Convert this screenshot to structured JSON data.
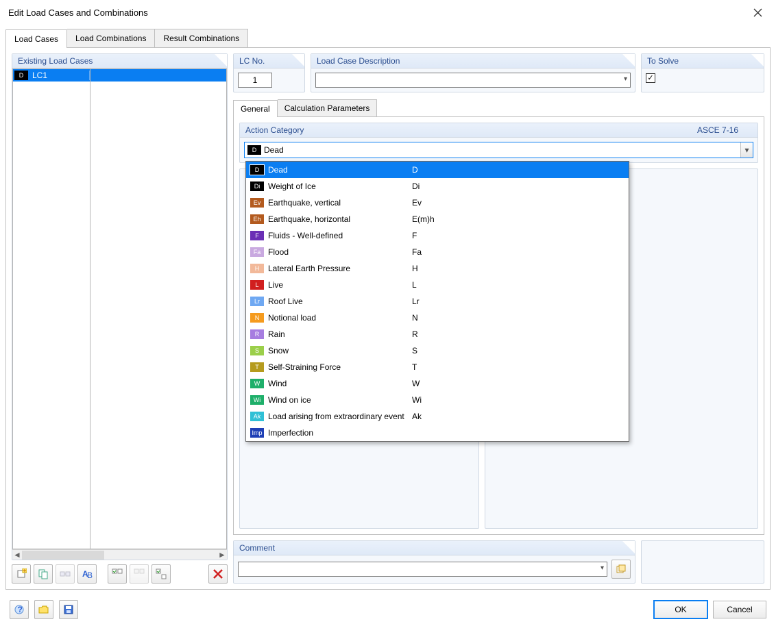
{
  "window": {
    "title": "Edit Load Cases and Combinations"
  },
  "main_tabs": {
    "load_cases": "Load Cases",
    "load_combinations": "Load Combinations",
    "result_combinations": "Result Combinations"
  },
  "left": {
    "existing_header": "Existing Load Cases",
    "rows": [
      {
        "tag": "D",
        "tag_bg": "#000000",
        "name": "LC1"
      }
    ]
  },
  "right": {
    "lc_no_label": "LC No.",
    "lc_no_value": "1",
    "desc_label": "Load Case Description",
    "desc_value": "",
    "solve_label": "To Solve",
    "solve_checked": true
  },
  "sub_tabs": {
    "general": "General",
    "calc": "Calculation Parameters"
  },
  "action": {
    "header_left": "Action Category",
    "header_right": "ASCE 7-16",
    "selected": {
      "tag": "D",
      "tag_bg": "#000000",
      "name": "Dead"
    },
    "options": [
      {
        "tag": "D",
        "bg": "#000000",
        "name": "Dead",
        "sym": "D",
        "selected": true
      },
      {
        "tag": "Di",
        "bg": "#000000",
        "name": "Weight of Ice",
        "sym": "Di"
      },
      {
        "tag": "Ev",
        "bg": "#b35a1e",
        "name": "Earthquake, vertical",
        "sym": "Ev"
      },
      {
        "tag": "Eh",
        "bg": "#b35a1e",
        "name": "Earthquake, horizontal",
        "sym": "E(m)h"
      },
      {
        "tag": "F",
        "bg": "#6a2fb5",
        "name": "Fluids - Well-defined",
        "sym": "F"
      },
      {
        "tag": "Fa",
        "bg": "#c9a9e0",
        "name": "Flood",
        "sym": "Fa"
      },
      {
        "tag": "H",
        "bg": "#f2b99a",
        "name": "Lateral Earth Pressure",
        "sym": "H"
      },
      {
        "tag": "L",
        "bg": "#d11f1f",
        "name": "Live",
        "sym": "L"
      },
      {
        "tag": "Lr",
        "bg": "#6fa8f2",
        "name": "Roof Live",
        "sym": "Lr"
      },
      {
        "tag": "N",
        "bg": "#f59b1e",
        "name": "Notional load",
        "sym": "N"
      },
      {
        "tag": "R",
        "bg": "#a77de0",
        "name": "Rain",
        "sym": "R"
      },
      {
        "tag": "S",
        "bg": "#9bcf4a",
        "name": "Snow",
        "sym": "S"
      },
      {
        "tag": "T",
        "bg": "#b59b1e",
        "name": "Self-Straining Force",
        "sym": "T"
      },
      {
        "tag": "W",
        "bg": "#1eaf6a",
        "name": "Wind",
        "sym": "W"
      },
      {
        "tag": "Wi",
        "bg": "#1eaf6a",
        "name": "Wind on ice",
        "sym": "Wi"
      },
      {
        "tag": "Ak",
        "bg": "#2fc0d6",
        "name": "Load arising from extraordinary event",
        "sym": "Ak"
      },
      {
        "tag": "Imp",
        "bg": "#1e3fb5",
        "name": "Imperfection",
        "sym": ""
      }
    ]
  },
  "comment": {
    "label": "Comment",
    "value": ""
  },
  "footer": {
    "ok": "OK",
    "cancel": "Cancel"
  }
}
